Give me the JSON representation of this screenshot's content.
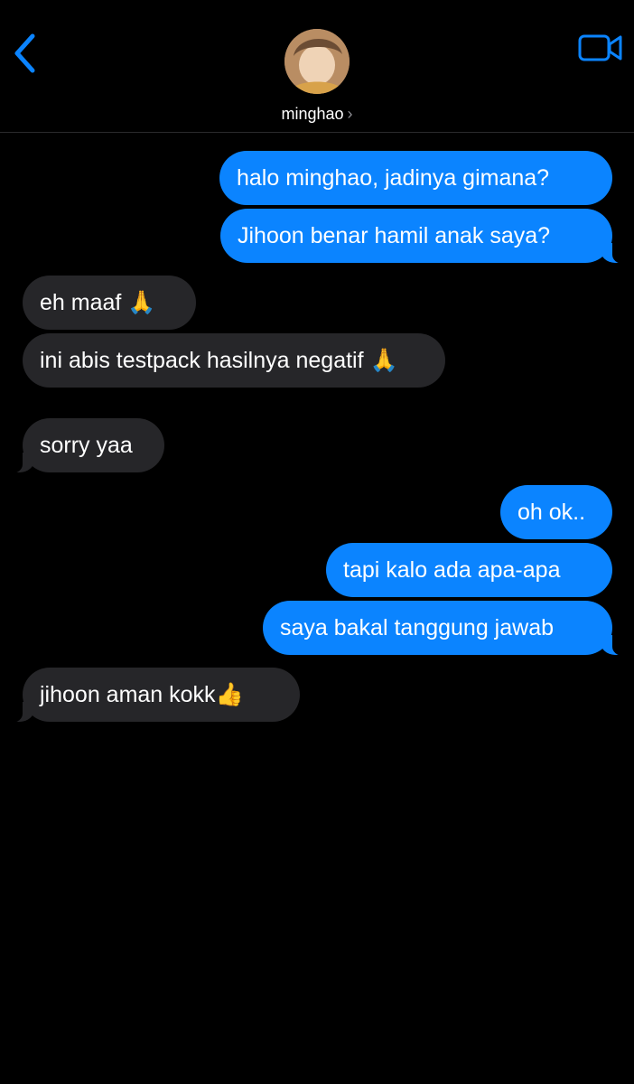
{
  "header": {
    "contact_name": "minghao",
    "chevron": "›",
    "back_icon": "chevron-left-icon",
    "video_icon": "video-camera-icon",
    "accent_color": "#0b84ff"
  },
  "messages": [
    {
      "side": "out",
      "text": "halo minghao, jadinya gimana?"
    },
    {
      "side": "out",
      "text": "Jihoon benar hamil anak saya?"
    },
    {
      "side": "in",
      "text": "eh maaf 🙏"
    },
    {
      "side": "in",
      "text": "ini abis testpack hasilnya negatif 🙏"
    },
    {
      "side": "in",
      "text": "sorry yaa"
    },
    {
      "side": "out",
      "text": "oh ok.."
    },
    {
      "side": "out",
      "text": "tapi kalo ada apa-apa"
    },
    {
      "side": "out",
      "text": "saya bakal tanggung jawab"
    },
    {
      "side": "in",
      "text": "jihoon aman kokk👍"
    }
  ],
  "colors": {
    "outgoing_bubble": "#0b84ff",
    "incoming_bubble": "#262629",
    "background": "#000000"
  }
}
